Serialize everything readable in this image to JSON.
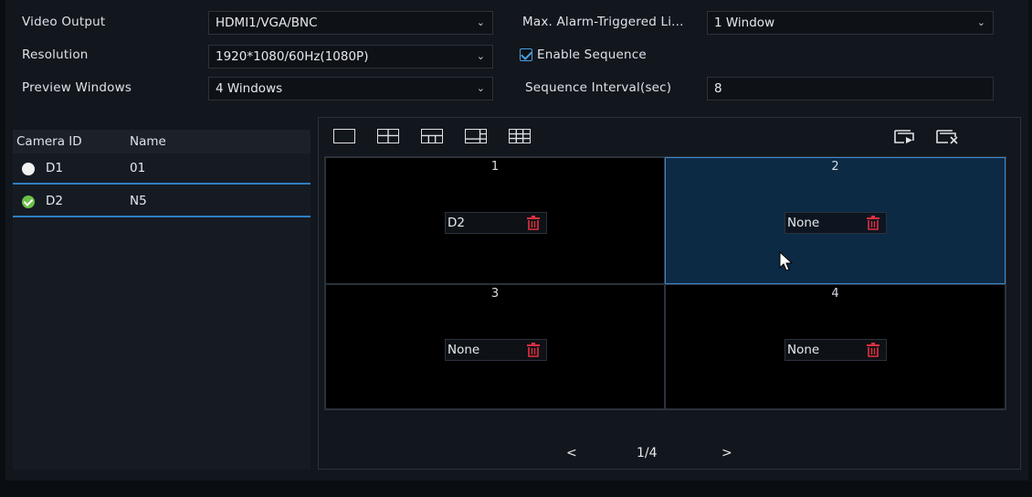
{
  "form": {
    "video_output_label": "Video Output",
    "video_output_value": "HDMI1/VGA/BNC",
    "resolution_label": "Resolution",
    "resolution_value": "1920*1080/60Hz(1080P)",
    "preview_windows_label": "Preview Windows",
    "preview_windows_value": "4 Windows",
    "max_alarm_label": "Max. Alarm-Triggered Li...",
    "max_alarm_value": "1 Window",
    "enable_sequence_label": "Enable Sequence",
    "enable_sequence_checked": true,
    "sequence_interval_label": "Sequence Interval(sec)",
    "sequence_interval_value": "8"
  },
  "camera_list": {
    "header_id": "Camera ID",
    "header_name": "Name",
    "rows": [
      {
        "id": "D1",
        "name": "01",
        "status": "online-white"
      },
      {
        "id": "D2",
        "name": "N5",
        "status": "assigned-green"
      }
    ]
  },
  "windows": [
    {
      "number": "1",
      "channel": "D2",
      "selected": false
    },
    {
      "number": "2",
      "channel": "None",
      "selected": true
    },
    {
      "number": "3",
      "channel": "None",
      "selected": false
    },
    {
      "number": "4",
      "channel": "None",
      "selected": false
    }
  ],
  "pager": {
    "prev": "<",
    "page": "1/4",
    "next": ">"
  },
  "icons": {
    "layouts": [
      "layout-1-icon",
      "layout-4-icon",
      "layout-6-icon",
      "layout-8-icon",
      "layout-9-icon"
    ],
    "actions": [
      "start-sequence-icon",
      "clear-all-icon"
    ]
  },
  "colors": {
    "accent": "#2f7fc2",
    "selected_window": "#0d2a45",
    "trash": "#e03040",
    "online_green": "#6cc04a"
  }
}
